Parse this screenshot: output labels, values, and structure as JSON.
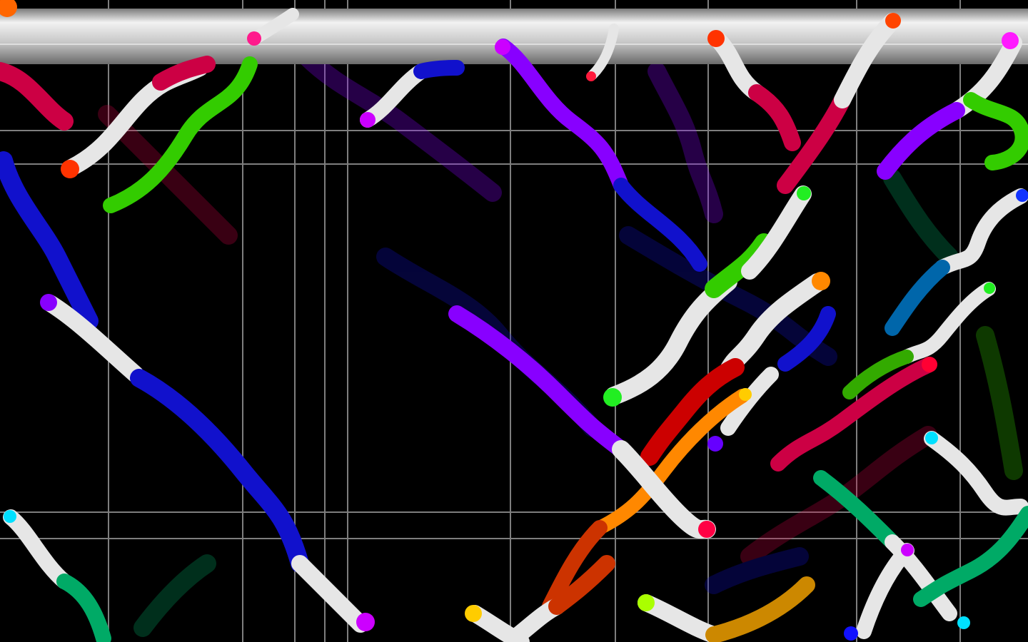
{
  "scene": {
    "background": "#000000",
    "grid_color": "#b8b8b8",
    "pipe_color": "#d0d0d0",
    "worm_body_color": "#e6e6e6"
  },
  "worm_colors": [
    "#ff3300",
    "#ff1a8c",
    "#33cc00",
    "#8800ff",
    "#1111cc",
    "#ff8800",
    "#00e0ff",
    "#ffcc00",
    "#cc0044",
    "#00aa66",
    "#cc00ff"
  ]
}
